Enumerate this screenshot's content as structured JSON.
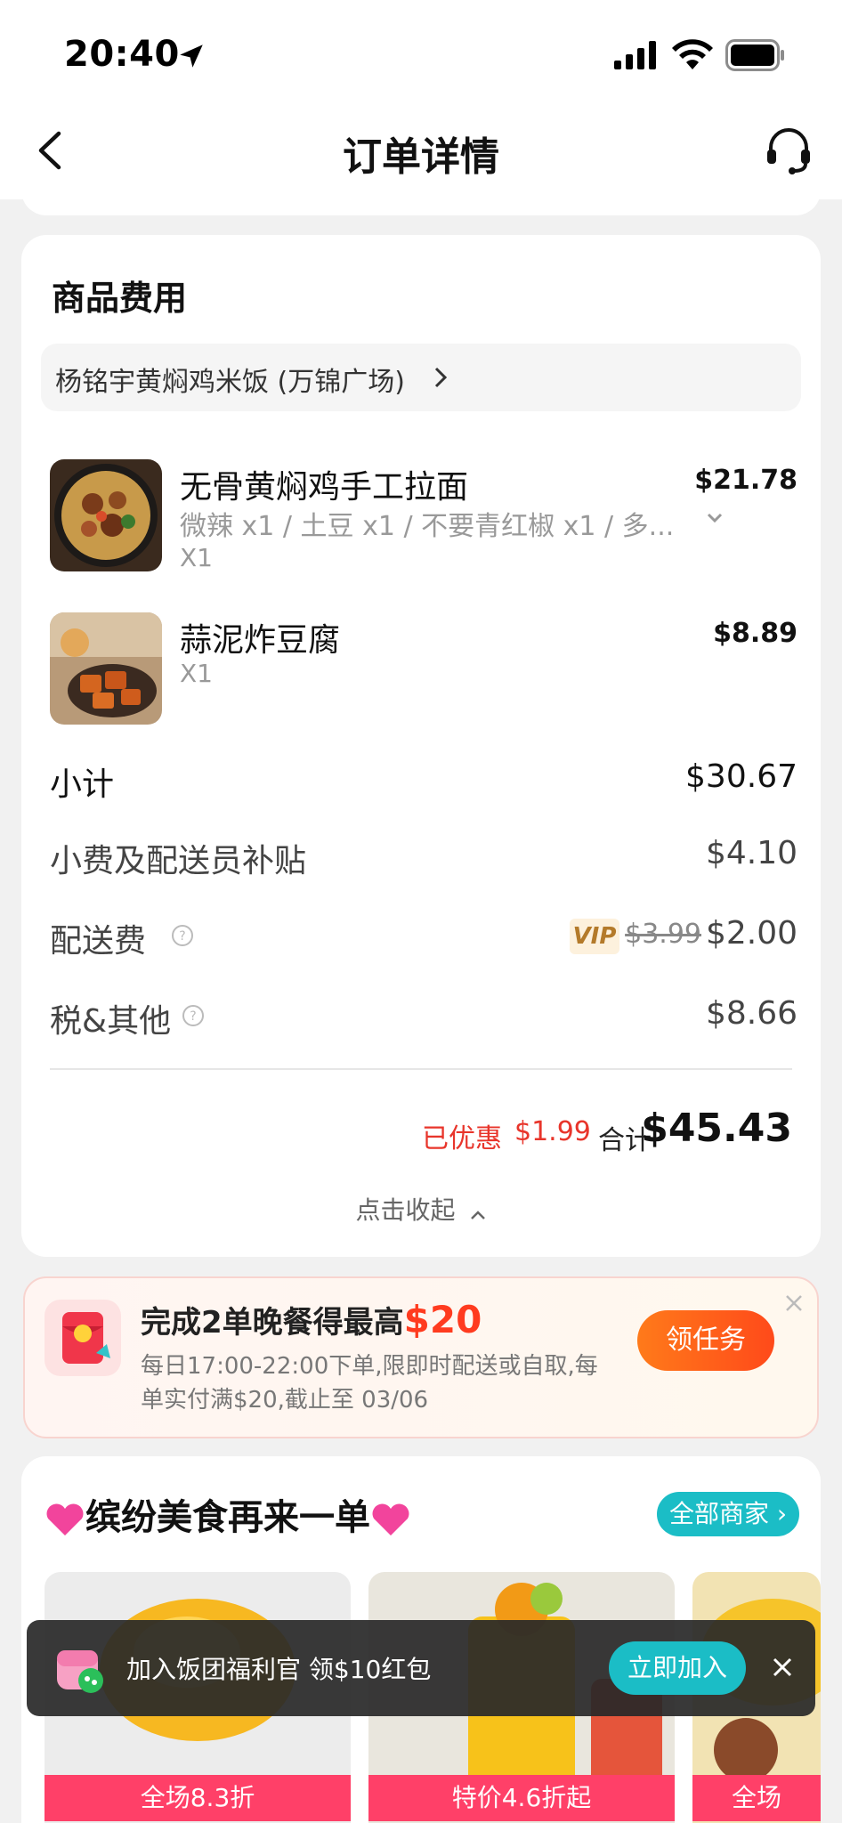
{
  "status_bar": {
    "time": "20:40"
  },
  "nav": {
    "title": "订单详情"
  },
  "fees_card": {
    "title": "商品费用",
    "store_name": "杨铭宇黄焖鸡米饭 (万锦广场)",
    "items": [
      {
        "name": "无骨黄焖鸡手工拉面",
        "price": "$21.78",
        "spec": "微辣 x1 / 土豆 x1 / 不要青红椒 x1 / 多...",
        "qty": "X1"
      },
      {
        "name": "蒜泥炸豆腐",
        "price": "$8.89",
        "qty": "X1"
      }
    ],
    "subtotal": {
      "label": "小计",
      "value": "$30.67"
    },
    "tip": {
      "label": "小费及配送员补贴",
      "value": "$4.10"
    },
    "delivery": {
      "label": "配送费",
      "badge": "VIP",
      "original": "$3.99",
      "value": "$2.00"
    },
    "tax": {
      "label": "税&其他",
      "value": "$8.66"
    },
    "discount_label": "已优惠",
    "discount_value": "$1.99",
    "total_label": "合计",
    "total_value": "$45.43",
    "collapse_label": "点击收起"
  },
  "promo": {
    "title_prefix": "完成2单晚餐得最高",
    "title_amount": "$20",
    "description": "每日17:00-22:00下单,限即时配送或自取,每单实付满$20,截止至 03/06",
    "button": "领任务"
  },
  "reorder": {
    "title": "缤纷美食再来一单",
    "all_merchants": "全部商家",
    "tiles": [
      {
        "banner": "全场8.3折"
      },
      {
        "banner": "特价4.6折起"
      },
      {
        "banner": "全场"
      }
    ]
  },
  "toast": {
    "text": "加入饭团福利官 领$10红包",
    "button": "立即加入"
  }
}
